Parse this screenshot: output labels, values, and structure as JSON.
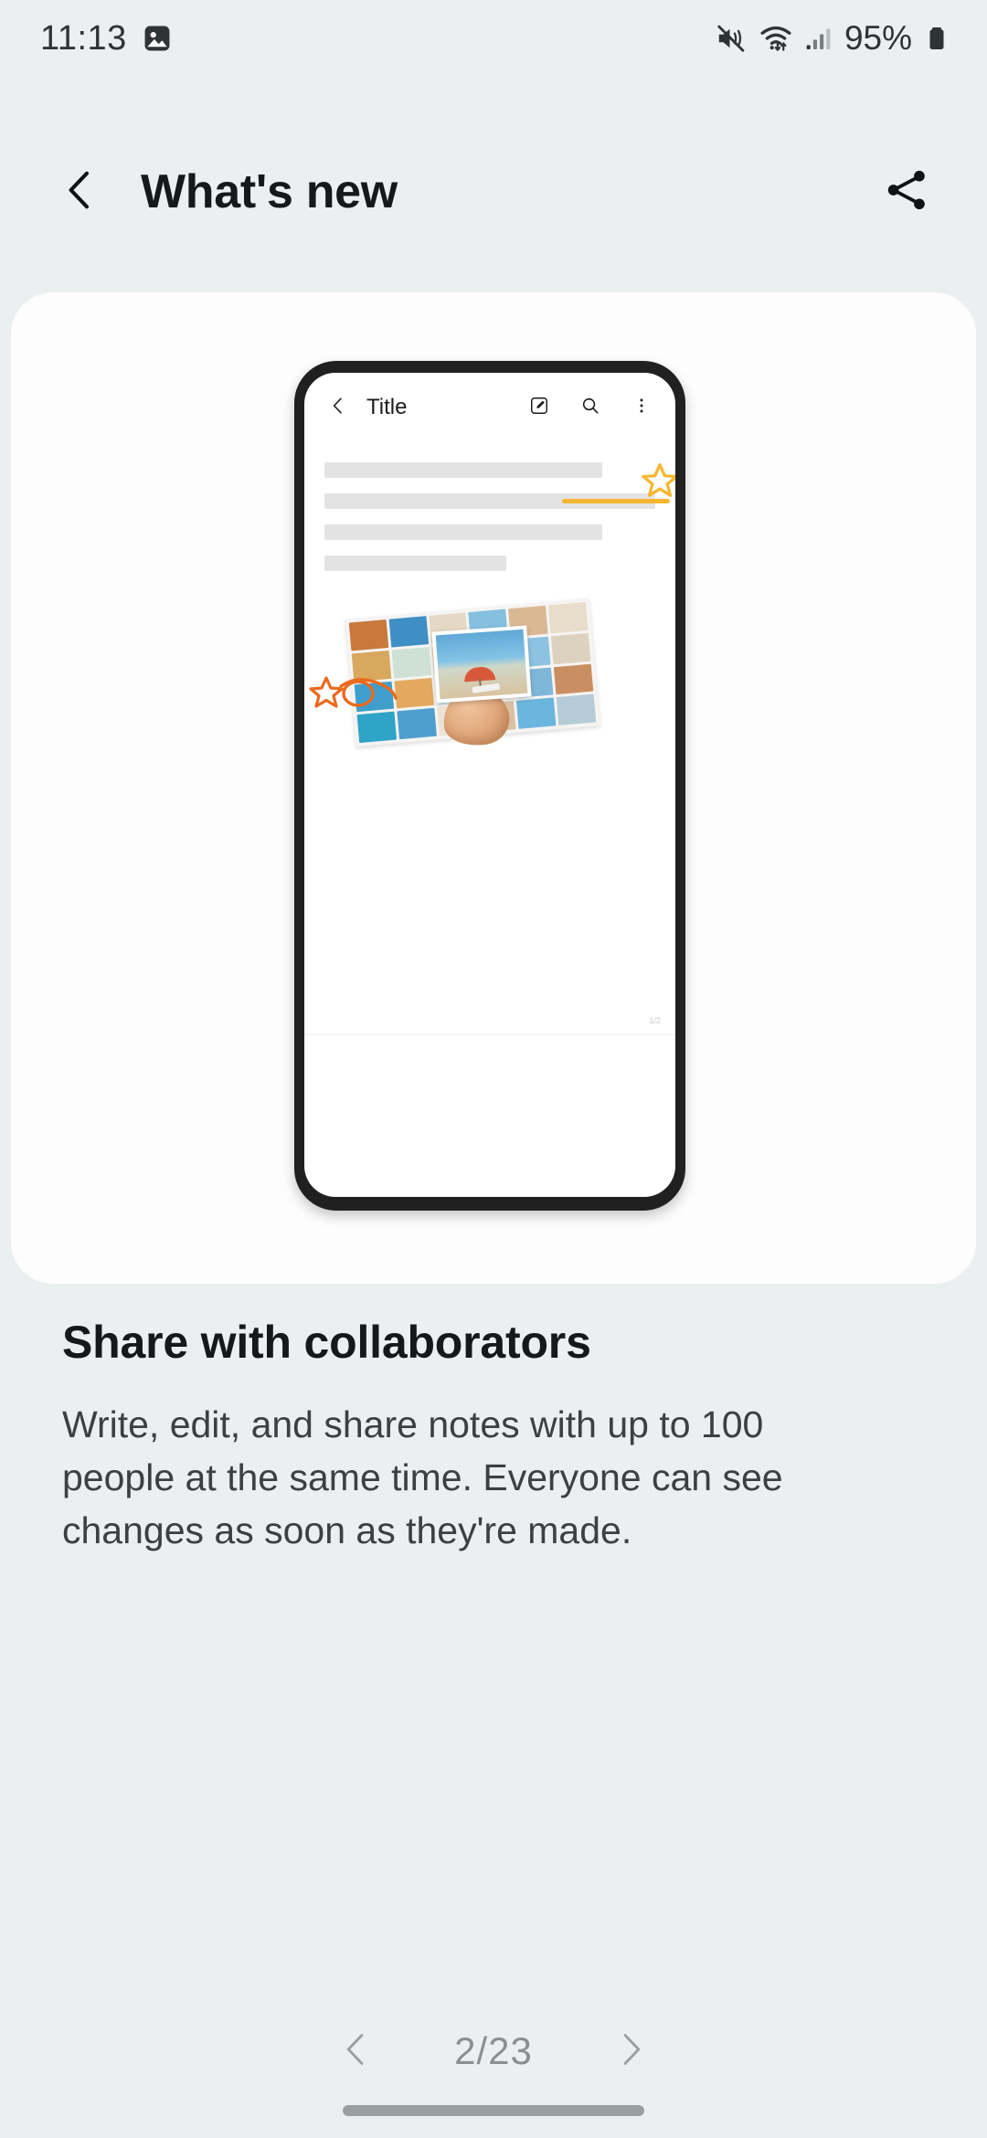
{
  "status_bar": {
    "time": "11:13",
    "battery_percent": "95%",
    "icons": [
      "gallery-image-icon",
      "mute-vibrate-icon",
      "wifi-icon",
      "cellular-signal-icon",
      "battery-icon"
    ]
  },
  "header": {
    "title": "What's new",
    "back_icon": "back-chevron-icon",
    "share_icon": "share-icon"
  },
  "phone_mockup": {
    "topbar": {
      "title": "Title",
      "back_icon": "back-chevron-icon",
      "actions": [
        "edit-pen-icon",
        "search-icon",
        "more-options-icon"
      ]
    },
    "page_indicator": "1/2",
    "annotations": {
      "yellow_cursor": "star-cursor-icon",
      "orange_cursor": "star-cursor-icon",
      "highlight_color": "#f5b731",
      "annotation_color": "#ea6a1e"
    }
  },
  "feature": {
    "title": "Share with collaborators",
    "description": "Write, edit, and share notes with up to 100 people at the same time. Everyone can see changes as soon as they're made."
  },
  "pager": {
    "prev_icon": "chevron-left-icon",
    "next_icon": "chevron-right-icon",
    "count": "2/23"
  },
  "theme": {
    "background": "#eceff0",
    "card": "#fdfdfd",
    "text_primary": "#17181a",
    "text_secondary": "#3d4043",
    "muted": "#8a8f91"
  }
}
